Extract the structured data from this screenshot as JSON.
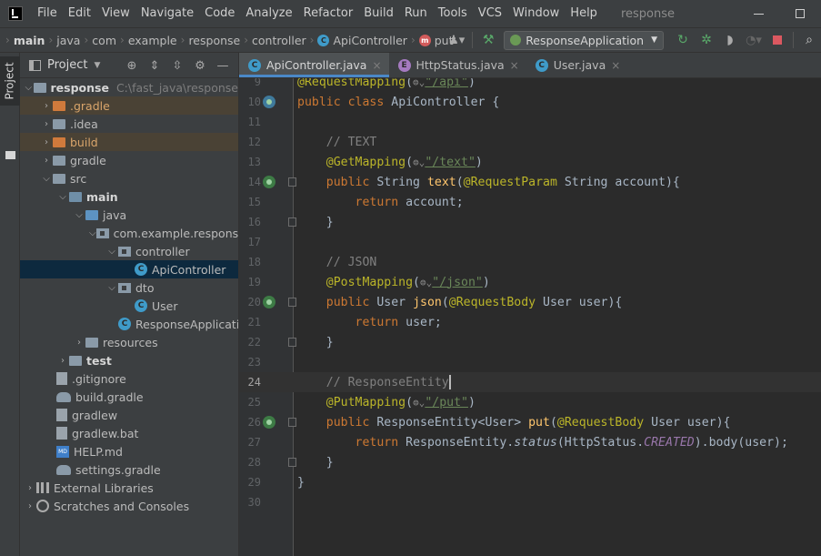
{
  "menubar": {
    "items": [
      "File",
      "Edit",
      "View",
      "Navigate",
      "Code",
      "Analyze",
      "Refactor",
      "Build",
      "Run",
      "Tools",
      "VCS",
      "Window",
      "Help"
    ],
    "project_name": "response"
  },
  "breadcrumb": {
    "items": [
      "main",
      "java",
      "com",
      "example",
      "response",
      "controller",
      "ApiController",
      "put"
    ]
  },
  "toolbar": {
    "run_config": "ResponseApplication"
  },
  "toolstrip": {
    "project_tab": "Project"
  },
  "project_panel": {
    "title": "Project",
    "root_name": "response",
    "root_path": "C:\\fast_java\\response",
    "items": [
      ".gradle",
      ".idea",
      "build",
      "gradle",
      "src",
      "main",
      "java",
      "com.example.response",
      "controller",
      "ApiController",
      "dto",
      "User",
      "ResponseApplication",
      "resources",
      "test",
      ".gitignore",
      "build.gradle",
      "gradlew",
      "gradlew.bat",
      "HELP.md",
      "settings.gradle",
      "External Libraries",
      "Scratches and Consoles"
    ]
  },
  "editor": {
    "tabs": [
      "ApiController.java",
      "HttpStatus.java",
      "User.java"
    ],
    "line_numbers": [
      "9",
      "10",
      "11",
      "12",
      "13",
      "14",
      "15",
      "16",
      "17",
      "18",
      "19",
      "20",
      "21",
      "22",
      "23",
      "24",
      "25",
      "26",
      "27",
      "28",
      "29",
      "30"
    ],
    "code": {
      "l9_annotation": "@RequestMapping",
      "l9_path": "\"/api\"",
      "l10_public": "public",
      "l10_class": "class",
      "l10_name": "ApiController {",
      "l12_comment": "// TEXT",
      "l13_annotation": "@GetMapping",
      "l13_path": "\"/text\"",
      "l14_public": "public",
      "l14_type": "String",
      "l14_fn": "text",
      "l14_annotation": "@RequestParam",
      "l14_rest": "String account){",
      "l15_return": "return",
      "l15_rest": "account;",
      "l16": "}",
      "l18_comment": "// JSON",
      "l19_annotation": "@PostMapping",
      "l19_path": "\"/json\"",
      "l20_public": "public",
      "l20_type": "User",
      "l20_fn": "json",
      "l20_annotation": "@RequestBody",
      "l20_rest": "User user){",
      "l21_return": "return",
      "l21_rest": "user;",
      "l22": "}",
      "l24_comment": "// ResponseEntity",
      "l25_annotation": "@PutMapping",
      "l25_path": "\"/put\"",
      "l26_public": "public",
      "l26_type": "ResponseEntity<User>",
      "l26_fn": "put",
      "l26_annotation": "@RequestBody",
      "l26_rest": "User user){",
      "l27_return": "return",
      "l27_a": "ResponseEntity.",
      "l27_status": "status",
      "l27_b": "(HttpStatus.",
      "l27_created": "CREATED",
      "l27_c": ").body(user);",
      "l28": "}",
      "l29": "}"
    }
  },
  "colors": {
    "editor_bg": "#2b2b2b",
    "panel_bg": "#3c3f41",
    "selection": "#0d293e",
    "keyword": "#cc7832",
    "annotation": "#bbb529",
    "string": "#6a8759",
    "comment": "#808080",
    "function": "#ffc66d"
  }
}
